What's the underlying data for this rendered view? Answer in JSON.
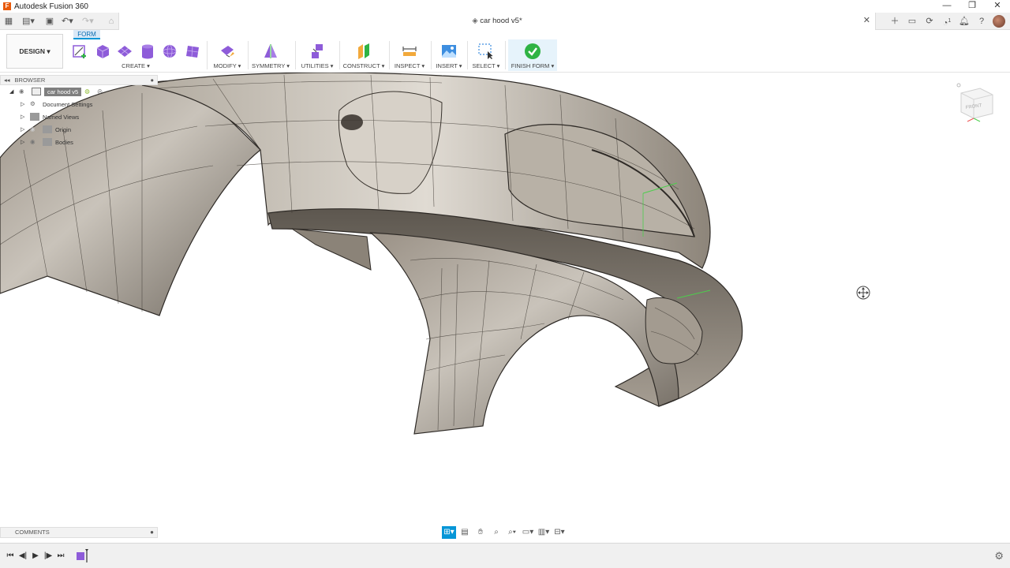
{
  "app": {
    "title": "Autodesk Fusion 360"
  },
  "document": {
    "tab_title": "car hood v5*"
  },
  "workspace": {
    "label": "DESIGN ▾",
    "active_tab": "FORM"
  },
  "ribbon": {
    "create": "CREATE ▾",
    "modify": "MODIFY ▾",
    "symmetry": "SYMMETRY ▾",
    "utilities": "UTILITIES ▾",
    "construct": "CONSTRUCT ▾",
    "inspect": "INSPECT ▾",
    "insert": "INSERT ▾",
    "select": "SELECT ▾",
    "finish_form": "FINISH FORM ▾"
  },
  "browser": {
    "title": "BROWSER",
    "root": "car hood v5",
    "items": [
      "Document Settings",
      "Named Views",
      "Origin",
      "Bodies"
    ]
  },
  "comments": {
    "title": "COMMENTS"
  },
  "viewcube": {
    "face_label": "FRONT"
  },
  "notifications": {
    "job_count": "1"
  },
  "colors": {
    "accent": "#0696d7",
    "form_purple": "#8e5cd9",
    "finish_green": "#2fb344"
  }
}
